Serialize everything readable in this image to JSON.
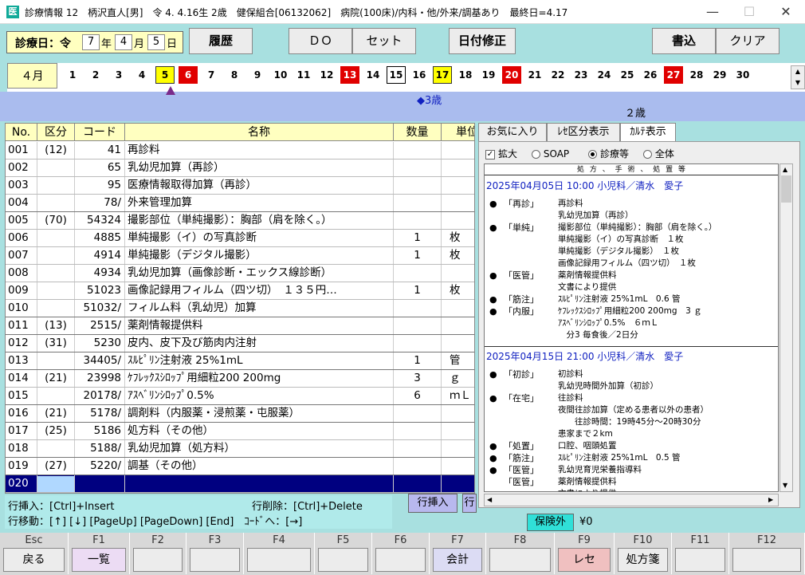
{
  "window": {
    "app_icon": "医",
    "title": "診療情報 12　柄沢直人[男]　令 4. 4.16生 2歳　健保組合[06132062]　病院(100床)/内科・他/外来/調基あり　最終日=4.17",
    "min": "—",
    "max": "☐",
    "close": "✕"
  },
  "toolbar": {
    "date_label": "診療日：令",
    "year": "7",
    "year_unit": "年",
    "month": "4",
    "month_unit": "月",
    "day": "5",
    "day_unit": "日",
    "history": "履歴",
    "do": "ＤＯ",
    "set": "セット",
    "fix_date": "日付修正",
    "save": "書込",
    "clear": "クリア"
  },
  "calendar": {
    "month": "４月",
    "days": [
      {
        "d": "1",
        "s": ""
      },
      {
        "d": "2",
        "s": ""
      },
      {
        "d": "3",
        "s": ""
      },
      {
        "d": "4",
        "s": ""
      },
      {
        "d": "5",
        "s": "yellow"
      },
      {
        "d": "6",
        "s": "red"
      },
      {
        "d": "7",
        "s": ""
      },
      {
        "d": "8",
        "s": ""
      },
      {
        "d": "9",
        "s": ""
      },
      {
        "d": "10",
        "s": ""
      },
      {
        "d": "11",
        "s": ""
      },
      {
        "d": "12",
        "s": ""
      },
      {
        "d": "13",
        "s": "red"
      },
      {
        "d": "14",
        "s": ""
      },
      {
        "d": "15",
        "s": "framed"
      },
      {
        "d": "16",
        "s": ""
      },
      {
        "d": "17",
        "s": "yellow"
      },
      {
        "d": "18",
        "s": ""
      },
      {
        "d": "19",
        "s": ""
      },
      {
        "d": "20",
        "s": "red"
      },
      {
        "d": "21",
        "s": ""
      },
      {
        "d": "22",
        "s": ""
      },
      {
        "d": "23",
        "s": ""
      },
      {
        "d": "24",
        "s": ""
      },
      {
        "d": "25",
        "s": ""
      },
      {
        "d": "26",
        "s": ""
      },
      {
        "d": "27",
        "s": "red"
      },
      {
        "d": "28",
        "s": ""
      },
      {
        "d": "29",
        "s": ""
      },
      {
        "d": "30",
        "s": ""
      }
    ],
    "age_marker": "◆3歳",
    "age_current": "２歳",
    "scroll_up": "▲",
    "scroll_down": "▼"
  },
  "table": {
    "headers": [
      "No.",
      "区分",
      "コード",
      "名称",
      "数量",
      "単位"
    ],
    "rows": [
      {
        "no": "001",
        "kubun": "(12)",
        "code": "41",
        "name": "再診料",
        "qty": "",
        "unit": ""
      },
      {
        "no": "002",
        "kubun": "",
        "code": "65",
        "name": "乳幼児加算（再診）",
        "qty": "",
        "unit": ""
      },
      {
        "no": "003",
        "kubun": "",
        "code": "95",
        "name": "医療情報取得加算（再診）",
        "qty": "",
        "unit": ""
      },
      {
        "no": "004",
        "kubun": "",
        "code": "78/",
        "name": "外来管理加算",
        "qty": "",
        "unit": ""
      },
      {
        "no": "005",
        "kubun": "(70)",
        "code": "54324",
        "name": "撮影部位（単純撮影）：胸部（肩を除く。）",
        "qty": "",
        "unit": ""
      },
      {
        "no": "006",
        "kubun": "",
        "code": "4885",
        "name": "単純撮影（イ）の写真診断",
        "qty": "1",
        "unit": "枚"
      },
      {
        "no": "007",
        "kubun": "",
        "code": "4914",
        "name": "単純撮影（デジタル撮影）",
        "qty": "1",
        "unit": "枚"
      },
      {
        "no": "008",
        "kubun": "",
        "code": "4934",
        "name": "乳幼児加算（画像診断・エックス線診断）",
        "qty": "",
        "unit": ""
      },
      {
        "no": "009",
        "kubun": "",
        "code": "51023",
        "name": "画像記録用フィルム（四ツ切）　１３５円…",
        "qty": "1",
        "unit": "枚"
      },
      {
        "no": "010",
        "kubun": "",
        "code": "51032/",
        "name": "フィルム料（乳幼児）加算",
        "qty": "",
        "unit": ""
      },
      {
        "no": "011",
        "kubun": "(13)",
        "code": "2515/",
        "name": "薬剤情報提供料",
        "qty": "",
        "unit": ""
      },
      {
        "no": "012",
        "kubun": "(31)",
        "code": "5230",
        "name": "皮内、皮下及び筋肉内注射",
        "qty": "",
        "unit": ""
      },
      {
        "no": "013",
        "kubun": "",
        "code": "34405/",
        "name": "ｽﾙﾋﾟﾘﾝ注射液 25%1mL",
        "qty": "1",
        "unit": "管"
      },
      {
        "no": "014",
        "kubun": "(21)",
        "code": "23998",
        "name": "ｹﾌﾚｯｸｽｼﾛｯﾌﾟ用細粒200 200mg",
        "qty": "3",
        "unit": "ｇ"
      },
      {
        "no": "015",
        "kubun": "",
        "code": "20178/",
        "name": "ｱｽﾍﾞﾘﾝｼﾛｯﾌﾟ0.5%",
        "qty": "6",
        "unit": "ｍＬ"
      },
      {
        "no": "016",
        "kubun": "(21)",
        "code": "5178/",
        "name": "調剤料（内服薬・浸煎薬・屯服薬）",
        "qty": "",
        "unit": ""
      },
      {
        "no": "017",
        "kubun": "(25)",
        "code": "5186",
        "name": "処方料（その他）",
        "qty": "",
        "unit": ""
      },
      {
        "no": "018",
        "kubun": "",
        "code": "5188/",
        "name": "乳幼児加算（処方料）",
        "qty": "",
        "unit": ""
      },
      {
        "no": "019",
        "kubun": "(27)",
        "code": "5220/",
        "name": "調基（その他）",
        "qty": "",
        "unit": ""
      },
      {
        "no": "020",
        "kubun": "",
        "code": "",
        "name": "",
        "qty": "",
        "unit": ""
      }
    ]
  },
  "help": {
    "line1a": "行挿入：[Ctrl]+Insert",
    "line1b": "行削除：[Ctrl]+Delete",
    "line2": "行移動：[↑] [↓] [PageUp] [PageDown] [End]　ｺｰﾄﾞへ：[→]",
    "insert_btn": "行挿入",
    "delete_btn": "行"
  },
  "panel": {
    "tabs": [
      "お気に入り",
      "ﾚｾ区分表示",
      "ｶﾙﾃ表示"
    ],
    "expand_label": "拡大",
    "radio_soap": "SOAP",
    "radio_shinryo": "診療等",
    "radio_all": "全体",
    "karte_header": "処 方 、 手 術 、 処 置 等",
    "visit1_date": "2025年04月05日 10:00 小児科／清水　愛子",
    "visit1": [
      {
        "b": "●",
        "c": "「再診」",
        "i": "再診料"
      },
      {
        "b": "",
        "c": "",
        "i": "乳幼児加算（再診）"
      },
      {
        "b": "●",
        "c": "「単純」",
        "i": "撮影部位（単純撮影）：胸部（肩を除く。）"
      },
      {
        "b": "",
        "c": "",
        "i": "単純撮影（イ）の写真診断　１枚"
      },
      {
        "b": "",
        "c": "",
        "i": "単純撮影（デジタル撮影）　１枚"
      },
      {
        "b": "",
        "c": "",
        "i": "画像記録用フィルム（四ツ切）　１枚"
      },
      {
        "b": "●",
        "c": "「医管」",
        "i": "薬剤情報提供料"
      },
      {
        "b": "",
        "c": "",
        "i": "文書により提供"
      },
      {
        "b": "●",
        "c": "「筋注」",
        "i": "ｽﾙﾋﾟﾘﾝ注射液 25%1mL　0.6 管"
      },
      {
        "b": "●",
        "c": "「内服」",
        "i": "ｹﾌﾚｯｸｽｼﾛｯﾌﾟ用細粒200 200mg　3 ｇ"
      },
      {
        "b": "",
        "c": "",
        "i": "ｱｽﾍﾞﾘﾝｼﾛｯﾌﾟ0.5%　６ｍＬ"
      },
      {
        "b": "",
        "c": "",
        "i": "　分3 毎食後／2日分"
      }
    ],
    "visit2_date": "2025年04月15日 21:00 小児科／清水　愛子",
    "visit2": [
      {
        "b": "●",
        "c": "「初診」",
        "i": "初診料"
      },
      {
        "b": "",
        "c": "",
        "i": "乳幼児時間外加算（初診）"
      },
      {
        "b": "●",
        "c": "「在宅」",
        "i": "往診料"
      },
      {
        "b": "",
        "c": "",
        "i": "夜間往診加算（定める患者以外の患者）"
      },
      {
        "b": "",
        "c": "",
        "i": "　　往診時間：19時45分～20時30分"
      },
      {
        "b": "",
        "c": "",
        "i": "患家まで２km"
      },
      {
        "b": "●",
        "c": "「処置」",
        "i": "口腔、咽頭処置"
      },
      {
        "b": "●",
        "c": "「筋注」",
        "i": "ｽﾙﾋﾟﾘﾝ注射液 25%1mL　0.5 管"
      },
      {
        "b": "●",
        "c": "「医管」",
        "i": "乳幼児育児栄養指導料"
      },
      {
        "b": "",
        "c": "「医管」",
        "i": "薬剤情報提供料"
      },
      {
        "b": "",
        "c": "",
        "i": "文書により提供"
      }
    ]
  },
  "hoken": {
    "label": "保険外",
    "amount": "¥0"
  },
  "fkeys": [
    {
      "key": "Esc",
      "label": "戻る",
      "style": ""
    },
    {
      "key": "F1",
      "label": "一覧",
      "style": "lav"
    },
    {
      "key": "F2",
      "label": "",
      "style": ""
    },
    {
      "key": "F3",
      "label": "",
      "style": ""
    },
    {
      "key": "F4",
      "label": "",
      "style": ""
    },
    {
      "key": "F5",
      "label": "",
      "style": ""
    },
    {
      "key": "F6",
      "label": "",
      "style": ""
    },
    {
      "key": "F7",
      "label": "会計",
      "style": "lav2"
    },
    {
      "key": "F8",
      "label": "",
      "style": ""
    },
    {
      "key": "F9",
      "label": "レセ",
      "style": "pink"
    },
    {
      "key": "F10",
      "label": "処方箋",
      "style": ""
    },
    {
      "key": "F11",
      "label": "",
      "style": ""
    },
    {
      "key": "F12",
      "label": "",
      "style": ""
    }
  ]
}
